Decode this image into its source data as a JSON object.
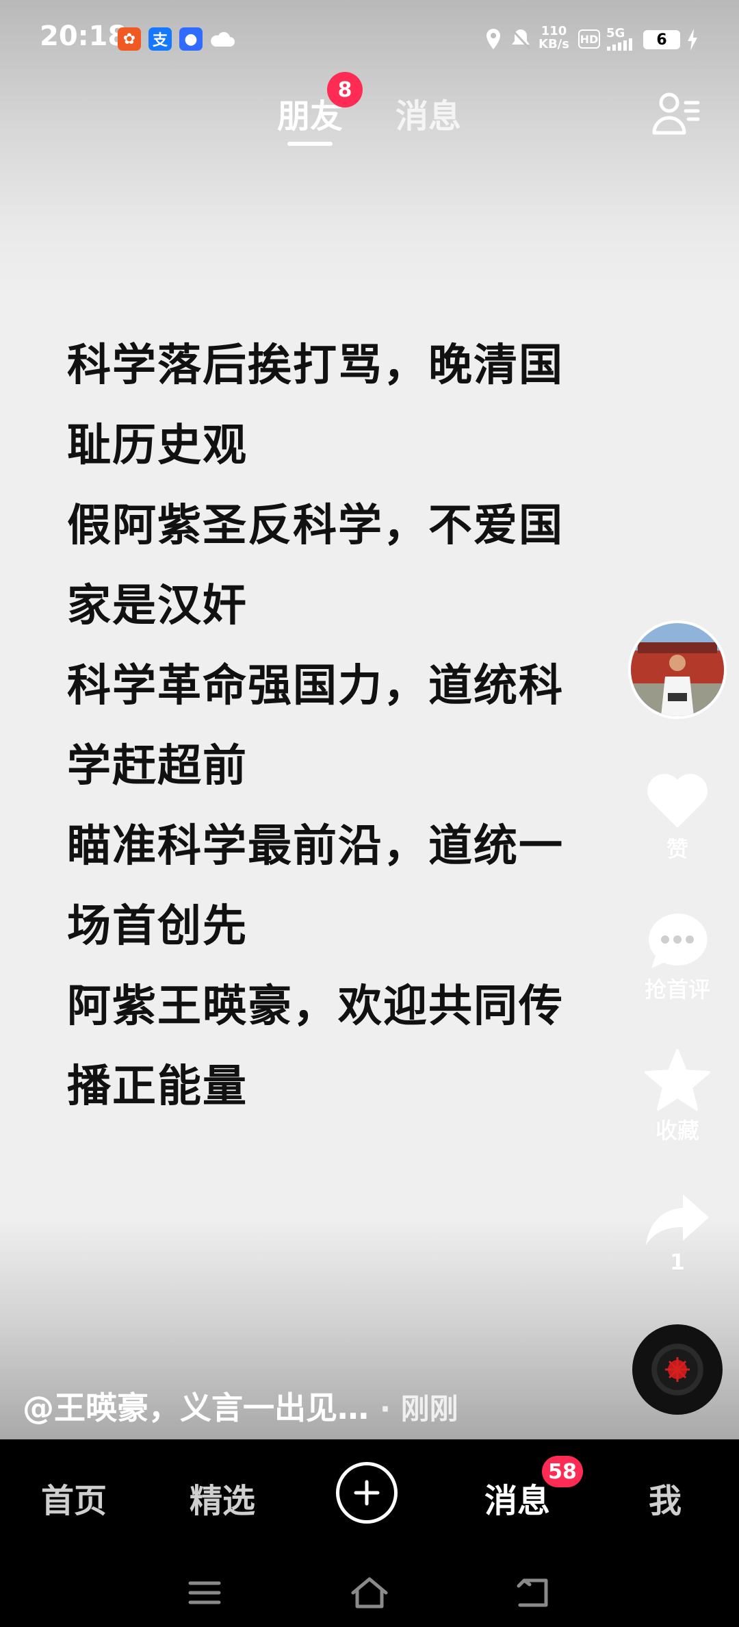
{
  "status_bar": {
    "time": "20:18",
    "net_speed_value": "110",
    "net_speed_unit": "KB/s",
    "hd_label": "HD",
    "network": "5G",
    "battery": "6"
  },
  "top_tabs": {
    "friends_label": "朋友",
    "friends_badge": "8",
    "messages_label": "消息"
  },
  "post": {
    "lines": [
      "科学落后挨打骂，晚清国",
      "耻历史观",
      "假阿紫圣反科学，不爱国",
      "家是汉奸",
      "科学革命强国力，道统科",
      "学赶超前",
      "瞄准科学最前沿，道统一",
      "场首创先",
      "阿紫王暎豪，欢迎共同传",
      "播正能量"
    ],
    "caption": "@王暎豪，义言一出见…",
    "time": "· 刚刚"
  },
  "rail": {
    "like_label": "赞",
    "comment_label": "抢首评",
    "favorite_label": "收藏",
    "share_count": "1"
  },
  "bottom_nav": {
    "home": "首页",
    "featured": "精选",
    "messages": "消息",
    "messages_badge": "58",
    "me": "我"
  },
  "colors": {
    "accent_badge": "#fe2c55",
    "nav_bg": "#000000"
  }
}
